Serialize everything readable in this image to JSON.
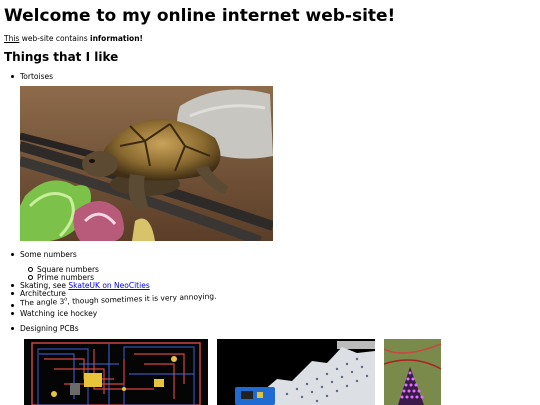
{
  "page": {
    "title": "Welcome to my online internet web-site!",
    "intro": {
      "abbr": "This",
      "middle": " web-site contains ",
      "bold": "information!"
    },
    "heading": "Things that I like"
  },
  "likes": {
    "tortoises": "Tortoises",
    "numbers": "Some numbers",
    "square": "Square numbers",
    "prime": "Prime numbers",
    "skating_prefix": "Skating, see ",
    "skating_link": "SkateUK on NeoCities",
    "architecture": "Architecture",
    "angle_prefix": "The angle 3",
    "angle_sup": "o",
    "angle_suffix": ", though sometimes it is very annoying.",
    "hockey": "Watching ice hockey",
    "pcbs": "Designing PCBs"
  },
  "colors": {
    "link": "#0000ee",
    "text": "#000000"
  },
  "icons": {
    "tortoise_photo": "tortoise-photo",
    "pcb_photos": [
      "pcb-layout-photo",
      "pcb-tree-photo",
      "pcb-glow-photo"
    ]
  }
}
